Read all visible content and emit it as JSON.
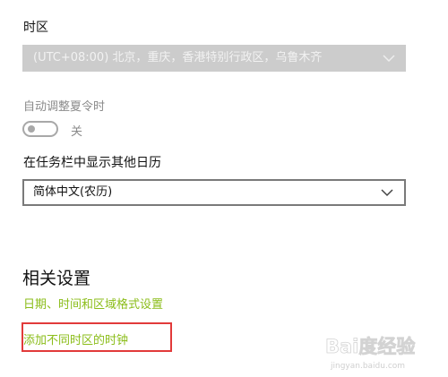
{
  "timezone": {
    "label": "时区",
    "selected": "(UTC+08:00) 北京，重庆，香港特别行政区，乌鲁木齐"
  },
  "dst": {
    "label": "自动调整夏令时",
    "state_label": "关",
    "enabled": false
  },
  "calendar": {
    "label": "在任务栏中显示其他日历",
    "selected": "简体中文(农历)"
  },
  "related": {
    "heading": "相关设置",
    "links": [
      "日期、时间和区域格式设置",
      "添加不同时区的时钟"
    ]
  },
  "watermark": {
    "brand": "Bai度经验",
    "url": "jingyan.baidu.com"
  },
  "colors": {
    "link": "#8bbd1a",
    "highlight": "#e23a3a",
    "disabled_select_bg": "#cccccc"
  }
}
